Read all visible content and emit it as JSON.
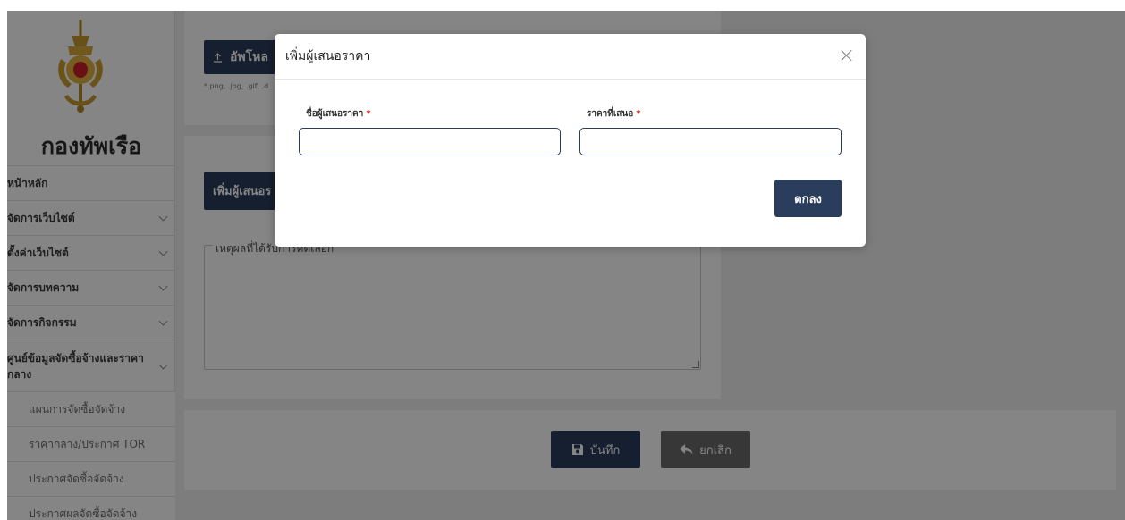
{
  "sidebar": {
    "brand": "กองทัพเรือ",
    "items": [
      {
        "label": "หน้าหลัก"
      },
      {
        "label": "จัดการเว็บไซต์"
      },
      {
        "label": "ตั้งค่าเว็บไซต์"
      },
      {
        "label": "จัดการบทความ"
      },
      {
        "label": "จัดการกิจกรรม"
      },
      {
        "label": "ศูนย์ข้อมูลจัดซื้อจ้างและราคากลาง"
      }
    ],
    "subitems": [
      {
        "label": "แผนการจัดซื้อจัดจ้าง"
      },
      {
        "label": "ราคากลาง/ประกาศ TOR"
      },
      {
        "label": "ประกาศจัดซื้อจัดจ้าง"
      },
      {
        "label": "ประกาศผลจัดซื้อจัดจ้าง"
      }
    ]
  },
  "main": {
    "upload_label": "อัพโหล",
    "upload_hint": "*.png, .jpg, .gif, .d",
    "add_bidder_label": "เพิ่มผู้เสนอร",
    "reason_legend": "เหตุผลที่ได้รับการคัดเลือก",
    "save_label": "บันทึก",
    "cancel_label": "ยกเลิก"
  },
  "modal": {
    "title": "เพิ่มผู้เสนอราคา",
    "name_label": "ชื่อผู้เสนอราคา",
    "price_label": "ราคาที่เสนอ",
    "required_mark": "*",
    "name_value": "",
    "price_value": "",
    "ok_label": "ตกลง"
  },
  "colors": {
    "primary": "#2b3d5c",
    "required": "#d0261e",
    "cancel": "#6a6a6a"
  }
}
